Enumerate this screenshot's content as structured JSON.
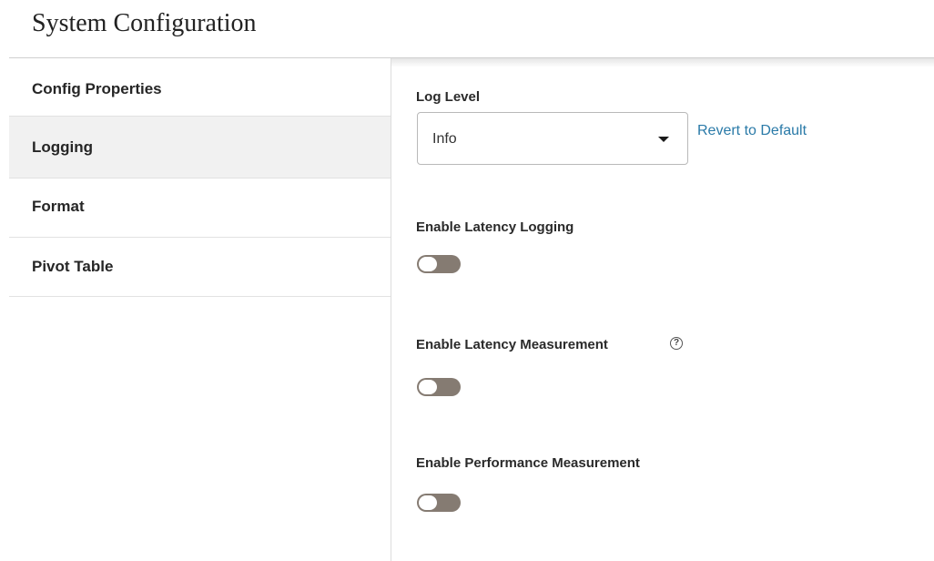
{
  "page": {
    "title": "System Configuration"
  },
  "sidebar": {
    "items": [
      {
        "label": "Config Properties",
        "active": false
      },
      {
        "label": "Logging",
        "active": true
      },
      {
        "label": "Format",
        "active": false
      },
      {
        "label": "Pivot Table",
        "active": false
      }
    ]
  },
  "logging": {
    "log_level": {
      "label": "Log Level",
      "value": "Info",
      "revert_label": "Revert to Default"
    },
    "latency_logging": {
      "label": "Enable Latency Logging",
      "enabled": false
    },
    "latency_measurement": {
      "label": "Enable Latency Measurement",
      "enabled": false,
      "help_glyph": "?"
    },
    "performance_measurement": {
      "label": "Enable Performance Measurement",
      "enabled": false
    }
  },
  "icons": {
    "dropdown": "chevron-down-icon",
    "help": "help-circle-icon"
  },
  "colors": {
    "accent_link": "#2a7aa8",
    "toggle_off": "#857b72",
    "active_item_bg": "#f1f1f1"
  }
}
